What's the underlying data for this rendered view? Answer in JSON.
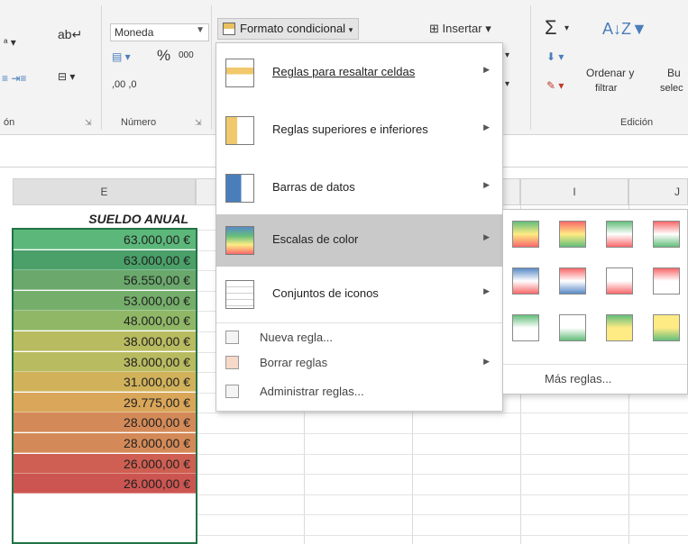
{
  "ribbon": {
    "number_format": "Moneda",
    "percent_label": "%",
    "thousands_label": "000",
    "decimals_label": ",00 ,0",
    "alignment_group": "ón",
    "number_group": "Número",
    "editing_group": "Edición",
    "conditional_format_button": "Formato condicional",
    "insert_button": "Insertar",
    "sort_filter_line1": "Ordenar y",
    "sort_filter_line2": "filtrar",
    "find_select_line1": "Bu",
    "find_select_line2": "selec"
  },
  "grid": {
    "columns": [
      {
        "label": "E"
      },
      {
        "label": "I"
      },
      {
        "label": "J"
      }
    ],
    "header": "SUELDO ANUAL",
    "rows": [
      {
        "value": "63.000,00 €",
        "color": "#5cb87a"
      },
      {
        "value": "63.000,00 €",
        "color": "#4aa068"
      },
      {
        "value": "56.550,00 €",
        "color": "#6aa86c"
      },
      {
        "value": "53.000,00 €",
        "color": "#75ae6a"
      },
      {
        "value": "48.000,00 €",
        "color": "#8fb766"
      },
      {
        "value": "38.000,00 €",
        "color": "#b8bb60"
      },
      {
        "value": "38.000,00 €",
        "color": "#b8bb60"
      },
      {
        "value": "31.000,00 €",
        "color": "#d1b25b"
      },
      {
        "value": "29.775,00 €",
        "color": "#d9a65a"
      },
      {
        "value": "28.000,00 €",
        "color": "#d48a58"
      },
      {
        "value": "28.000,00 €",
        "color": "#d48a58"
      },
      {
        "value": "26.000,00 €",
        "color": "#cf5f52"
      },
      {
        "value": "26.000,00 €",
        "color": "#cc5551"
      }
    ]
  },
  "menu": {
    "items": [
      {
        "label": "Reglas para resaltar celdas",
        "icon": "highlight-cells-rules-icon"
      },
      {
        "label": "Reglas superiores e inferiores",
        "icon": "top-bottom-rules-icon"
      },
      {
        "label": "Barras de datos",
        "icon": "data-bars-icon"
      },
      {
        "label": "Escalas de color",
        "icon": "color-scales-icon"
      },
      {
        "label": "Conjuntos de iconos",
        "icon": "icon-sets-icon"
      }
    ],
    "small_items": [
      {
        "label": "Nueva regla...",
        "icon": "new-rule-icon"
      },
      {
        "label": "Borrar reglas",
        "icon": "clear-rules-icon"
      },
      {
        "label": "Administrar reglas...",
        "icon": "manage-rules-icon"
      }
    ]
  },
  "submenu": {
    "more_rules": "Más reglas...",
    "swatches": [
      [
        "#63be7b",
        "#ffeb84",
        "#f8696b"
      ],
      [
        "#f8696b",
        "#ffeb84",
        "#63be7b"
      ],
      [
        "#63be7b",
        "#ffffff",
        "#f8696b"
      ],
      [
        "#f8696b",
        "#ffffff",
        "#63be7b"
      ],
      [
        "#5a8ac6",
        "#ffffff",
        "#f8696b"
      ],
      [
        "#f8696b",
        "#ffffff",
        "#5a8ac6"
      ],
      [
        "#ffffff",
        "#ffffff",
        "#f8696b"
      ],
      [
        "#f8696b",
        "#ffffff",
        "#ffffff"
      ],
      [
        "#63be7b",
        "#ffffff",
        "#ffffff"
      ],
      [
        "#ffffff",
        "#ffffff",
        "#63be7b"
      ],
      [
        "#63be7b",
        "#ffeb84",
        "#ffeb84"
      ],
      [
        "#ffeb84",
        "#ffeb84",
        "#63be7b"
      ]
    ]
  }
}
